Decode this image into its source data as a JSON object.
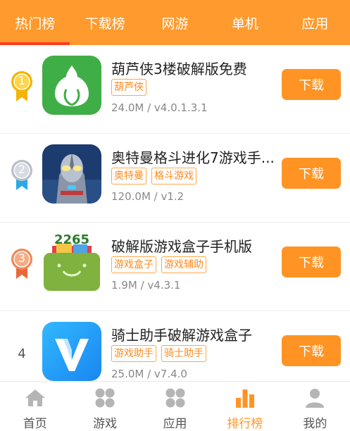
{
  "tabs": [
    {
      "label": "热门榜",
      "active": true
    },
    {
      "label": "下载榜",
      "active": false
    },
    {
      "label": "网游",
      "active": false
    },
    {
      "label": "单机",
      "active": false
    },
    {
      "label": "应用",
      "active": false
    }
  ],
  "apps": [
    {
      "rank": "1",
      "title": "葫芦侠3楼破解版免费",
      "tags": [
        "葫芦侠"
      ],
      "meta": "24.0M / v4.0.1.3.1",
      "button": "下载",
      "icon": "huluxia-gourd-icon"
    },
    {
      "rank": "2",
      "title": "奥特曼格斗进化7游戏手...",
      "tags": [
        "奥特曼",
        "格斗游戏"
      ],
      "meta": "120.0M / v1.2",
      "button": "下载",
      "icon": "ultraman-icon"
    },
    {
      "rank": "3",
      "title": "破解版游戏盒子手机版",
      "tags": [
        "游戏盒子",
        "游戏辅助"
      ],
      "meta": "1.9M / v4.3.1",
      "button": "下载",
      "icon": "2265-box-icon"
    },
    {
      "rank": "4",
      "title": "骑士助手破解游戏盒子",
      "tags": [
        "游戏助手",
        "骑士助手"
      ],
      "meta": "25.0M / v7.4.0",
      "button": "下载",
      "icon": "knight-v-icon"
    }
  ],
  "colors": {
    "accent": "#ff9424",
    "gold": "#f5b400",
    "silver": "#b9bec9",
    "bronze": "#ee8a5a",
    "ribbon": "#29a9e6"
  },
  "nav": [
    {
      "label": "首页",
      "icon": "home-icon",
      "active": false
    },
    {
      "label": "游戏",
      "icon": "game-grid-icon",
      "active": false
    },
    {
      "label": "应用",
      "icon": "app-grid-icon",
      "active": false
    },
    {
      "label": "排行榜",
      "icon": "ranking-bars-icon",
      "active": true
    },
    {
      "label": "我的",
      "icon": "profile-icon",
      "active": false
    }
  ]
}
